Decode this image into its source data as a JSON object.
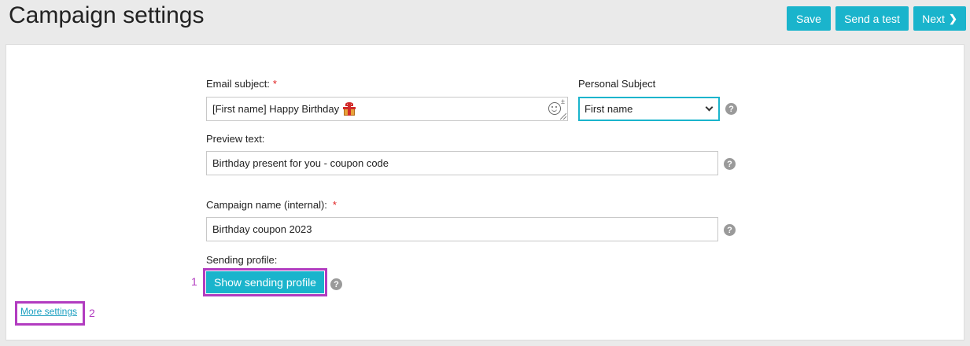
{
  "header": {
    "title": "Campaign settings",
    "save_label": "Save",
    "send_test_label": "Send a test",
    "next_label": "Next",
    "accent_color": "#1ab4cc"
  },
  "form": {
    "email_subject": {
      "label": "Email subject:",
      "required_mark": "*",
      "value": "[First name] Happy Birthday",
      "emoji_icon": "gift-icon"
    },
    "personal_subject": {
      "label": "Personal Subject",
      "selected": "First name"
    },
    "preview_text": {
      "label": "Preview text:",
      "value": "Birthday present for you - coupon code"
    },
    "campaign_name": {
      "label": "Campaign name (internal):",
      "required_mark": "*",
      "value": "Birthday coupon 2023"
    },
    "sending_profile": {
      "label": "Sending profile:",
      "button_label": "Show sending profile"
    },
    "help_glyph": "?"
  },
  "more_settings_label": "More settings",
  "annotations": {
    "marker_1": "1",
    "marker_2": "2",
    "highlight_color": "#b23cc0"
  }
}
